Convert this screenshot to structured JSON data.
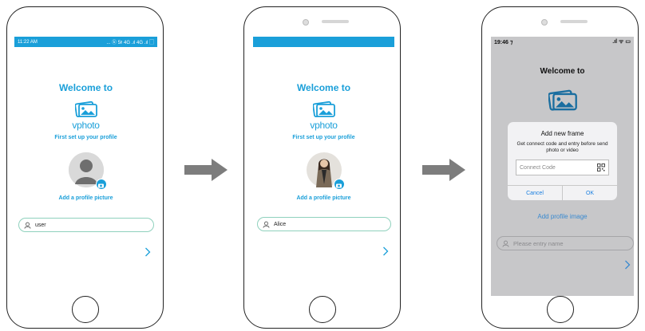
{
  "colors": {
    "accent": "#1a9fd9",
    "field_border": "#8fd1bd",
    "ios_overlay": "#c7c7c9",
    "ios_link": "#1a7fe0",
    "arrow": "#7d7d7d"
  },
  "screen1": {
    "status_time": "11:22 AM",
    "status_icons": "... ⓑ 5ᵍ 4G .ıl 4G .ıl ▢",
    "welcome": "Welcome to",
    "brand": "vphoto",
    "setup": "First set up your profile",
    "add_picture": "Add a profile picture",
    "name_value": "user"
  },
  "screen2": {
    "welcome": "Welcome to",
    "brand": "vphoto",
    "setup": "First set up your profile",
    "add_picture": "Add a profile picture",
    "name_value": "Alice"
  },
  "screen3": {
    "status_time": "19:46 ⁊",
    "status_icons": ".ıl ᯤ ▭",
    "welcome": "Welcome to",
    "dialog": {
      "title": "Add new frame",
      "message": "Get connect code and entry before send photo or video",
      "input_placeholder": "Connect Code",
      "cancel": "Cancel",
      "ok": "OK"
    },
    "add_image": "Add profile image",
    "name_placeholder": "Please entry name"
  },
  "icons": [
    "photo-logo-icon",
    "camera-icon",
    "user-icon",
    "chevron-right-icon",
    "qr-code-icon",
    "arrow-right-icon"
  ]
}
